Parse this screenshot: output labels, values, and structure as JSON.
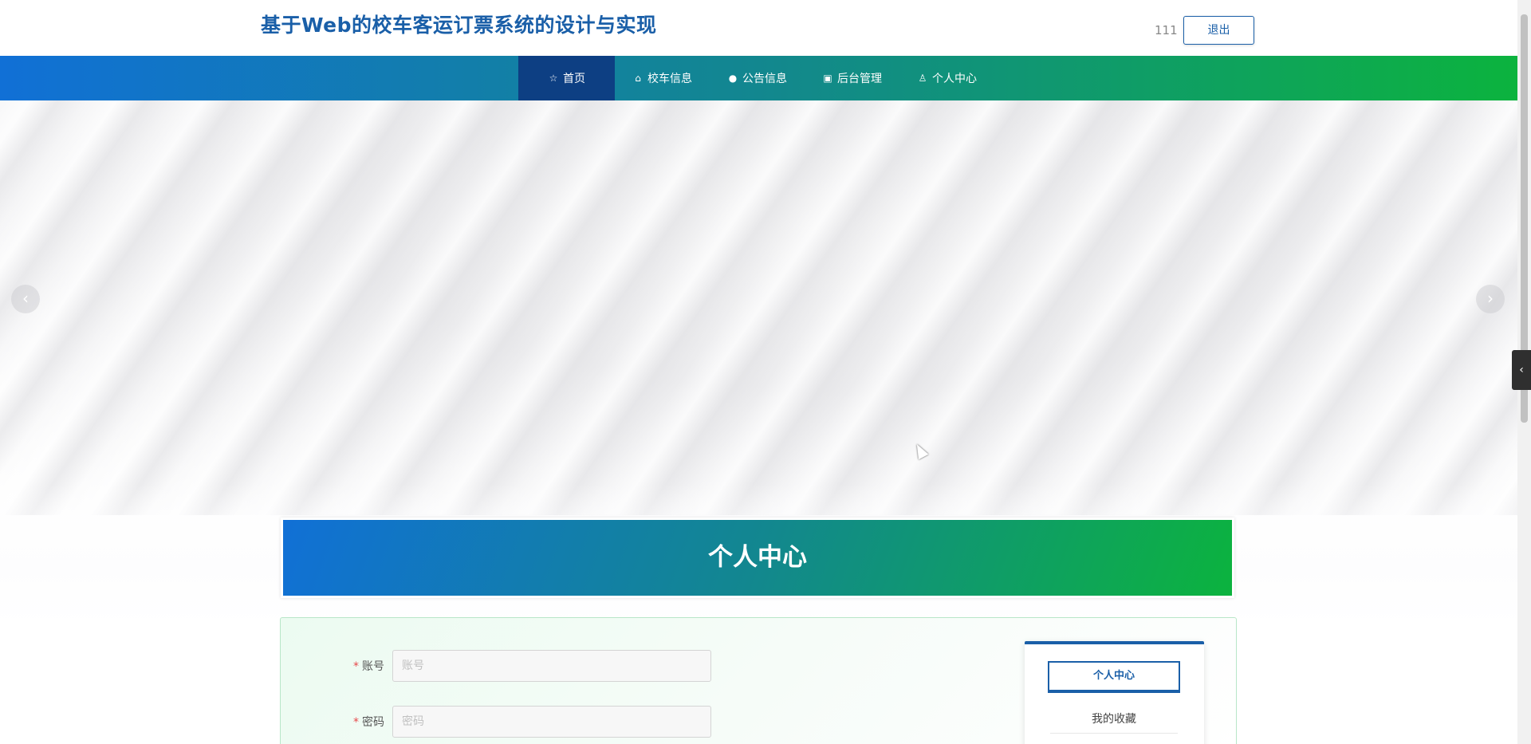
{
  "header": {
    "title": "基于Web的校车客运订票系统的设计与实现",
    "username": "111",
    "logout_label": "退出"
  },
  "nav": {
    "items": [
      {
        "label": "首页",
        "icon": "star-icon",
        "active": true
      },
      {
        "label": "校车信息",
        "icon": "bag-icon"
      },
      {
        "label": "公告信息",
        "icon": "info-icon"
      },
      {
        "label": "后台管理",
        "icon": "briefcase-icon"
      },
      {
        "label": "个人中心",
        "icon": "user-icon"
      }
    ]
  },
  "carousel": {
    "prev_icon": "chevron-left-icon",
    "next_icon": "chevron-right-icon"
  },
  "section": {
    "title": "个人中心"
  },
  "form": {
    "account": {
      "label": "账号",
      "placeholder": "账号",
      "value": ""
    },
    "password": {
      "label": "密码",
      "placeholder": "密码",
      "value": ""
    }
  },
  "side_menu": {
    "active_label": "个人中心",
    "links": [
      "我的收藏"
    ]
  },
  "colors": {
    "brand": "#1a5fa8",
    "nav_active": "#0d3f83",
    "gradient_start": "#1170d6",
    "gradient_end": "#0cb33e",
    "required": "#e6494b"
  }
}
